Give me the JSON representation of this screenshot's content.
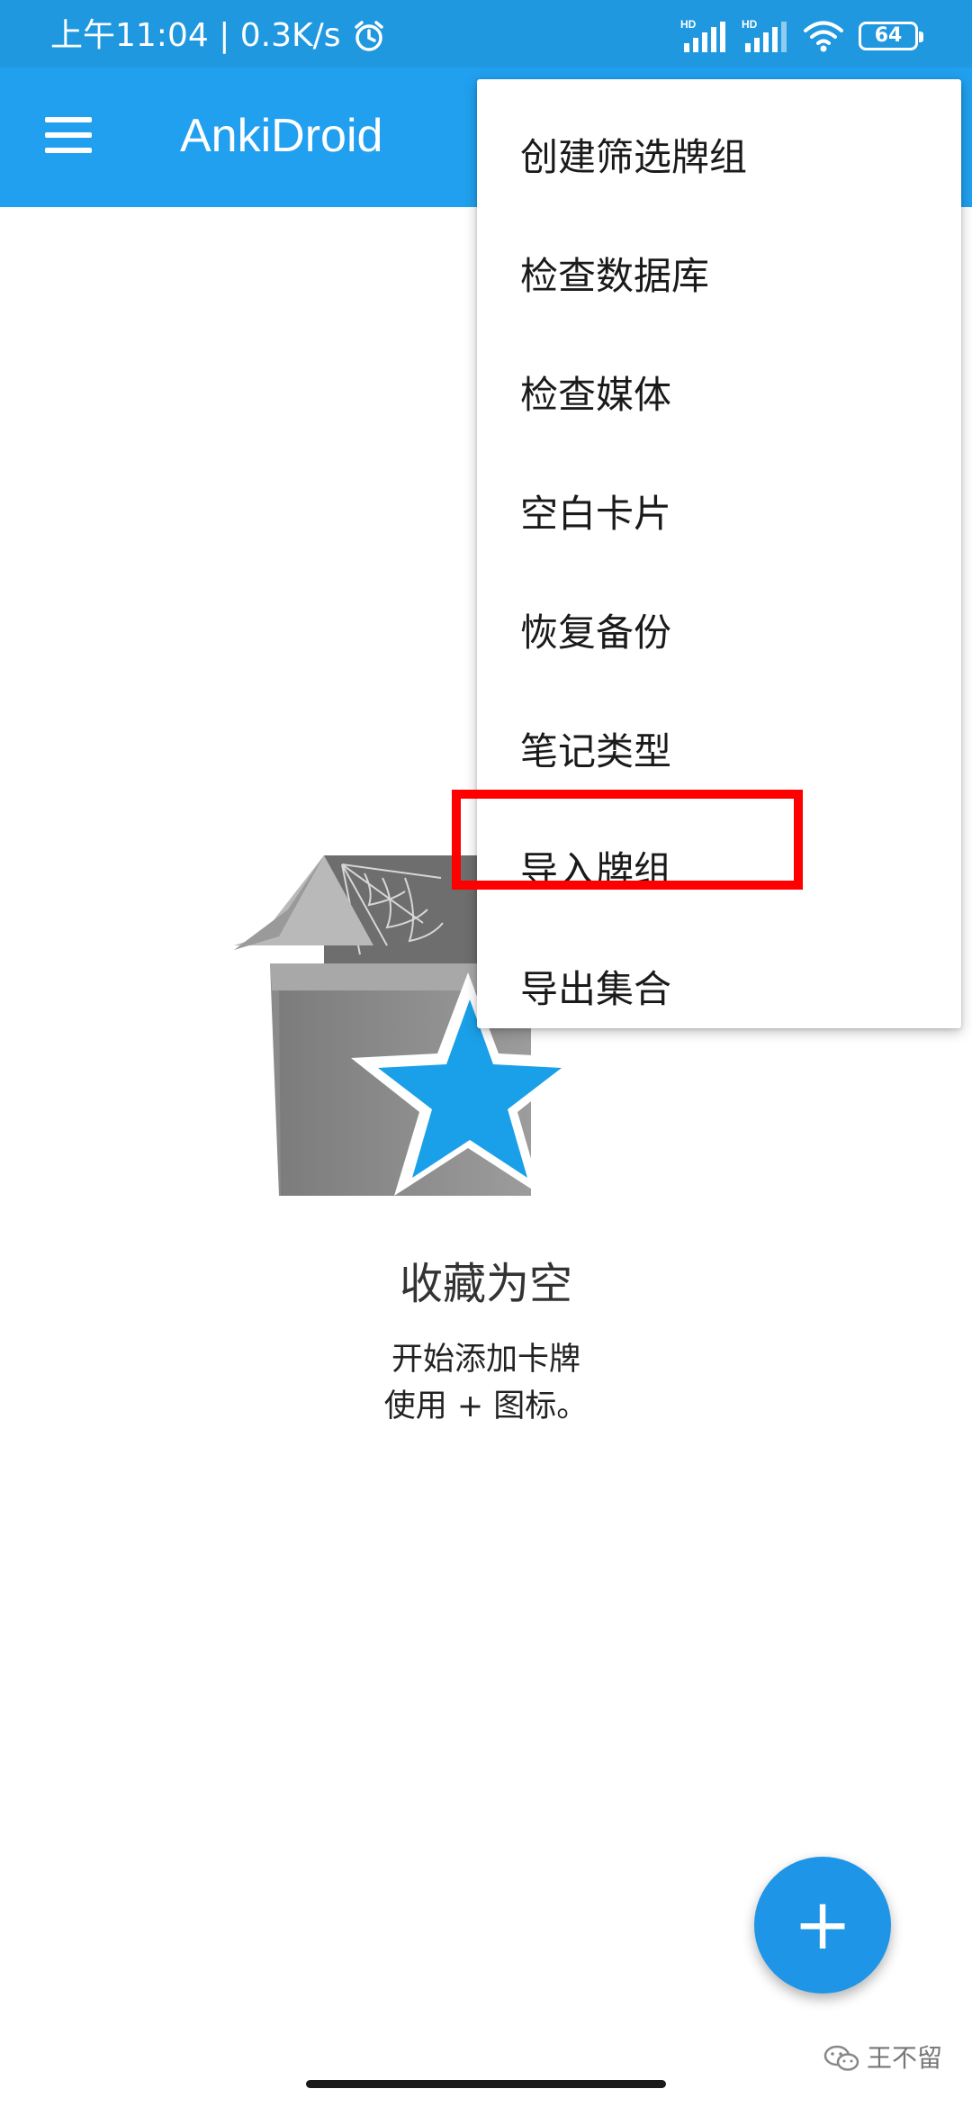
{
  "status_bar": {
    "time": "上午11:04",
    "speed": "0.3K/s",
    "battery": "64",
    "signal_label": "HD"
  },
  "app_bar": {
    "title": "AnkiDroid"
  },
  "overflow_menu": {
    "items": [
      {
        "label": "创建筛选牌组"
      },
      {
        "label": "检查数据库"
      },
      {
        "label": "检查媒体"
      },
      {
        "label": "空白卡片"
      },
      {
        "label": "恢复备份"
      },
      {
        "label": "笔记类型"
      },
      {
        "label": "导入牌组",
        "highlighted": true
      },
      {
        "label": "导出集合"
      }
    ]
  },
  "empty_state": {
    "title": "收藏为空",
    "subtitle_line1": "开始添加卡牌",
    "subtitle_line2": "使用 + 图标。"
  },
  "fab": {
    "label": "+"
  },
  "watermark": {
    "text": "王不留"
  },
  "colors": {
    "primary": "#21a0ef",
    "status_bar": "#1f98e0",
    "fab": "#1e95e6",
    "highlight": "#ff0000",
    "star": "#1aa0e8"
  }
}
